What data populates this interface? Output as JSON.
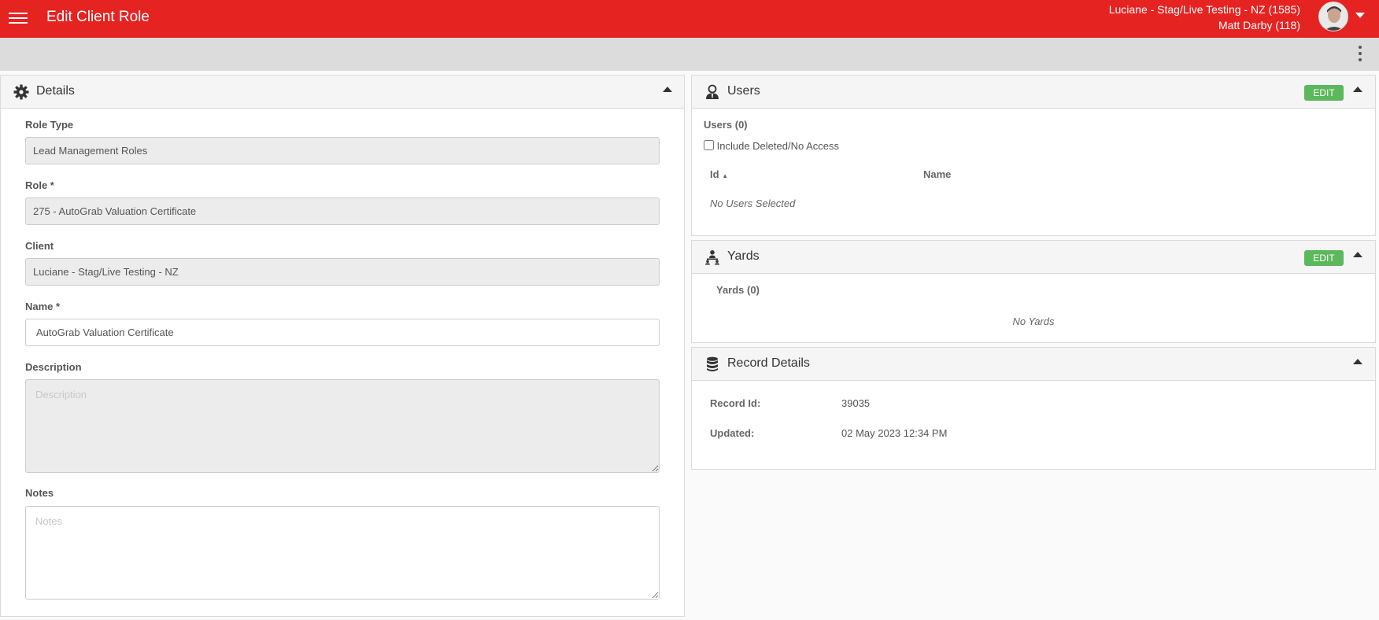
{
  "header": {
    "title": "Edit Client Role",
    "client_line": "Luciane - Stag/Live Testing - NZ (1585)",
    "user_line": "Matt Darby (118)"
  },
  "details": {
    "title": "Details",
    "role_type_label": "Role Type",
    "role_type_value": "Lead Management Roles",
    "role_label": "Role *",
    "role_value": "275 - AutoGrab Valuation Certificate",
    "client_label": "Client",
    "client_value": "Luciane - Stag/Live Testing - NZ",
    "name_label": "Name *",
    "name_value": "AutoGrab Valuation Certificate",
    "description_label": "Description",
    "description_placeholder": "Description",
    "notes_label": "Notes",
    "notes_placeholder": "Notes"
  },
  "users": {
    "title": "Users",
    "edit_label": "EDIT",
    "count_label": "Users (0)",
    "include_deleted_label": "Include Deleted/No Access",
    "col_id": "Id",
    "sort_indicator": "▲",
    "col_name": "Name",
    "empty_text": "No Users Selected"
  },
  "yards": {
    "title": "Yards",
    "edit_label": "EDIT",
    "count_label": "Yards (0)",
    "empty_text": "No Yards"
  },
  "record": {
    "title": "Record Details",
    "record_id_label": "Record Id:",
    "record_id_value": "39035",
    "updated_label": "Updated:",
    "updated_value": "02 May 2023 12:34 PM"
  },
  "colors": {
    "brand_red": "#e52321",
    "edit_green": "#5cb85c"
  }
}
